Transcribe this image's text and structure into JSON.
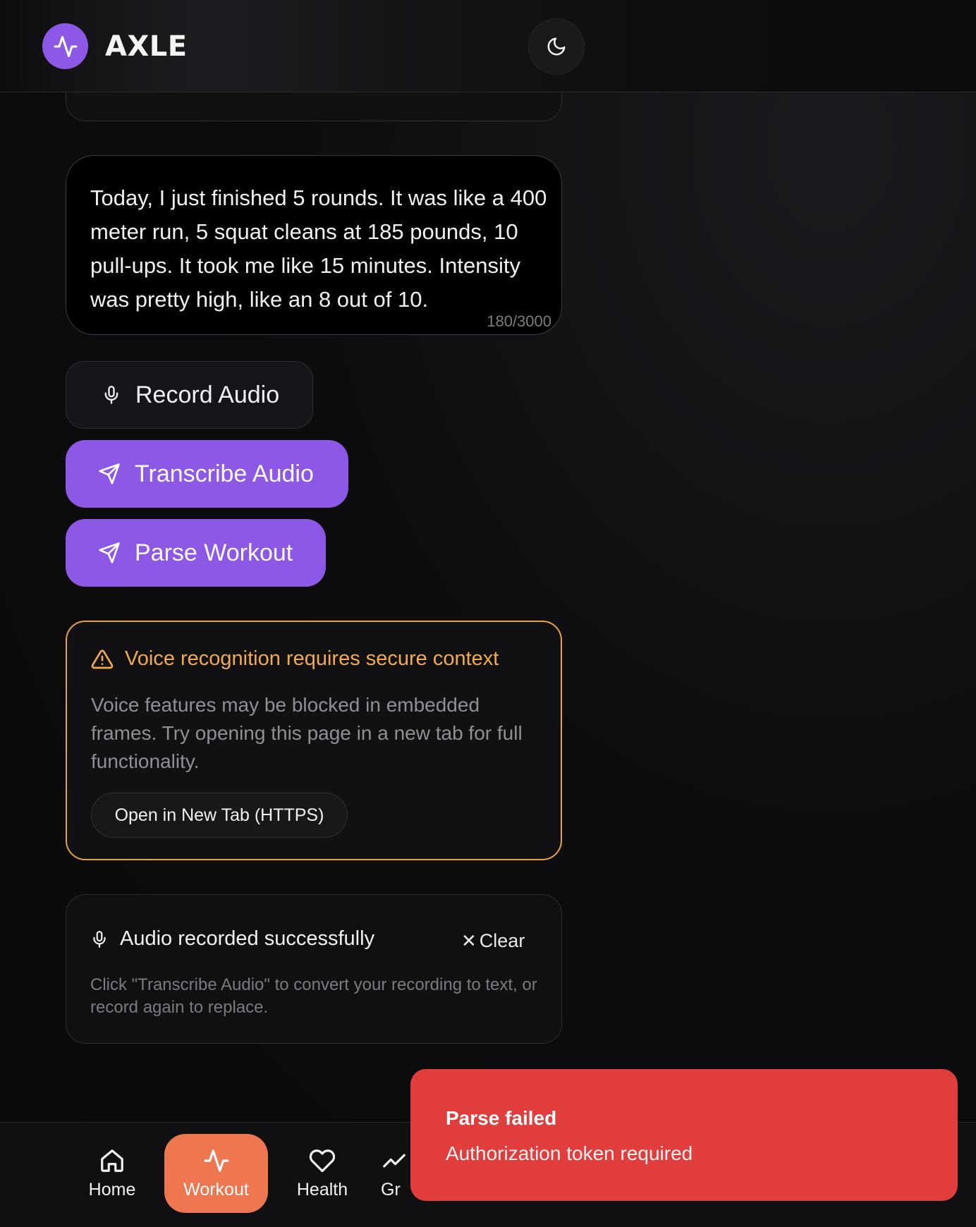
{
  "app": {
    "title": "AXLE",
    "accent": "#8d58e6",
    "logo_icon": "activity-icon",
    "theme_icon": "moon-icon"
  },
  "workout_input": {
    "text": "Today, I just finished 5 rounds. It was like a 400 meter run, 5 squat cleans at 185 pounds, 10 pull-ups. It took me like 15 minutes. Intensity was pretty high, like an 8 out of 10.",
    "char_count": "180/3000"
  },
  "actions": {
    "record_label": "Record Audio",
    "record_icon": "microphone-icon",
    "transcribe_label": "Transcribe Audio",
    "transcribe_icon": "send-icon",
    "parse_label": "Parse Workout",
    "parse_icon": "send-icon"
  },
  "warning": {
    "title": "Voice recognition requires secure context",
    "body": "Voice features may be blocked in embedded frames. Try opening this page in a new tab for full functionality.",
    "button_label": "Open in New Tab (HTTPS)",
    "color": "#e8a23c",
    "icon": "warning-triangle-icon"
  },
  "audio_status": {
    "title": "Audio recorded successfully",
    "clear_label": "Clear",
    "body": "Click \"Transcribe Audio\" to convert your recording to text, or record again to replace.",
    "icon": "microphone-icon"
  },
  "nav": {
    "items": [
      {
        "label": "Home",
        "icon": "home-icon"
      },
      {
        "label": "Workout",
        "icon": "activity-icon",
        "active": true
      },
      {
        "label": "Health",
        "icon": "heart-icon"
      },
      {
        "label": "Gr",
        "icon": "growth-icon"
      }
    ],
    "active_color": "#ef7750"
  },
  "toast": {
    "title": "Parse failed",
    "message": "Authorization token required",
    "color": "#e23d3d"
  }
}
